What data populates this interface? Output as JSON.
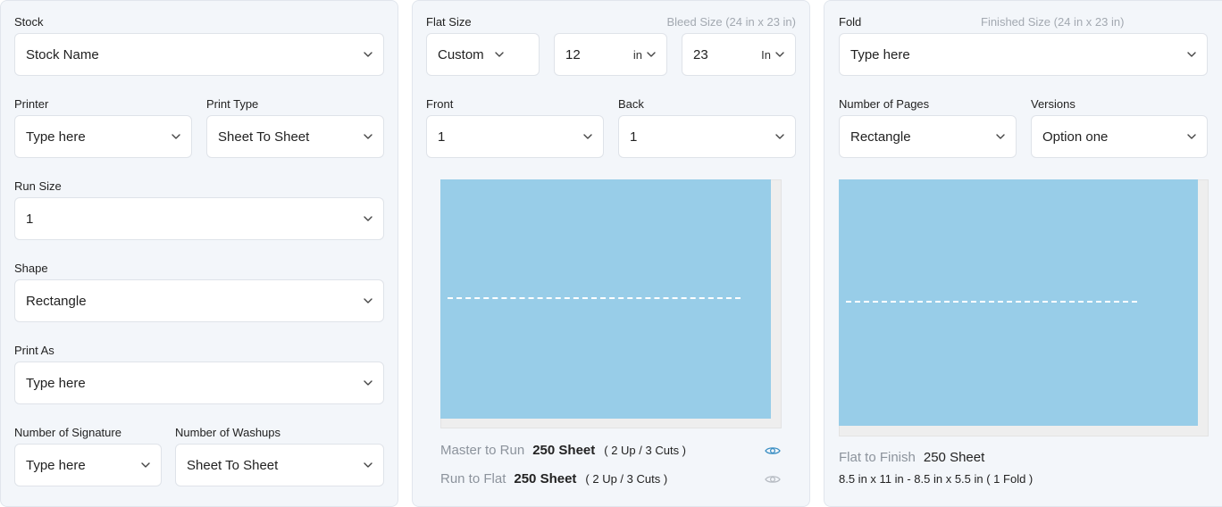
{
  "left": {
    "stock": {
      "label": "Stock",
      "value": "Stock Name"
    },
    "printer": {
      "label": "Printer",
      "value": "Type here"
    },
    "print_type": {
      "label": "Print Type",
      "value": "Sheet To Sheet"
    },
    "run_size": {
      "label": "Run Size",
      "value": "1"
    },
    "shape": {
      "label": "Shape",
      "value": "Rectangle"
    },
    "print_as": {
      "label": "Print As",
      "value": "Type here"
    },
    "signature": {
      "label": "Number of Signature",
      "value": "Type here"
    },
    "washups": {
      "label": "Number of Washups",
      "value": "Sheet To Sheet"
    }
  },
  "middle": {
    "flat_size_label": "Flat Size",
    "bleed_size": "Bleed Size (24 in x 23 in)",
    "size_preset": "Custom",
    "width": {
      "value": "12",
      "unit": "in"
    },
    "height": {
      "value": "23",
      "unit": "In"
    },
    "front": {
      "label": "Front",
      "value": "1"
    },
    "back": {
      "label": "Back",
      "value": "1"
    },
    "master_to_run": {
      "label": "Master to Run",
      "value": "250 Sheet",
      "note": "( 2 Up / 3 Cuts )"
    },
    "run_to_flat": {
      "label": "Run to Flat",
      "value": "250 Sheet",
      "note": "( 2 Up / 3 Cuts )"
    }
  },
  "right": {
    "fold": {
      "label": "Fold",
      "value": "Type here"
    },
    "finished_size": "Finished Size (24 in x 23 in)",
    "pages": {
      "label": "Number of Pages",
      "value": "Rectangle"
    },
    "versions": {
      "label": "Versions",
      "value": "Option one"
    },
    "flat_to_finish": {
      "label": "Flat to Finish",
      "value": "250 Sheet"
    },
    "dimensions": "8.5 in x 11 in - 8.5 in x 5.5 in  (  1 Fold )"
  },
  "colors": {
    "sheet": "#98cde8",
    "eye_active": "#3b8fc4",
    "eye_inactive": "#b7bcc3"
  },
  "icons": [
    "chevron-down-icon",
    "eye-icon"
  ]
}
